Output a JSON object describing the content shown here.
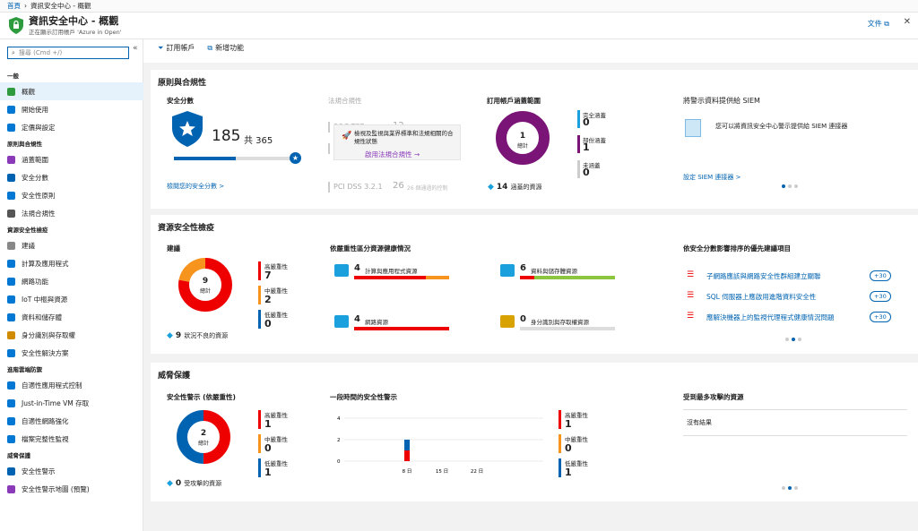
{
  "breadcrumb": {
    "home": "首頁",
    "current": "資訊安全中心 - 概觀"
  },
  "header": {
    "title": "資訊安全中心 - 概觀",
    "subtitle": "正在顯示訂用帳戶 'Azure in Open'",
    "docs": "文件",
    "close": "✕"
  },
  "search": {
    "placeholder": "搜尋 (Cmd +/)"
  },
  "sidebar": {
    "sections": [
      {
        "title": "一般",
        "items": [
          {
            "label": "概觀",
            "color": "#2e9c3e"
          },
          {
            "label": "開始使用",
            "color": "#0078d4"
          },
          {
            "label": "定價與設定",
            "color": "#0078d4"
          }
        ]
      },
      {
        "title": "原則與合規性",
        "items": [
          {
            "label": "涵蓋範圍",
            "color": "#8a3ab9"
          },
          {
            "label": "安全分數",
            "color": "#0063b1"
          },
          {
            "label": "安全性原則",
            "color": "#0078d4"
          },
          {
            "label": "法規合規性",
            "color": "#555"
          }
        ]
      },
      {
        "title": "資源安全性檢疫",
        "items": [
          {
            "label": "建議",
            "color": "#888"
          },
          {
            "label": "計算及應用程式",
            "color": "#0078d4"
          },
          {
            "label": "網路功能",
            "color": "#0078d4"
          },
          {
            "label": "IoT 中樞與資源",
            "color": "#0078d4"
          },
          {
            "label": "資料和儲存體",
            "color": "#0078d4"
          },
          {
            "label": "身分識別與存取權",
            "color": "#d18b00"
          },
          {
            "label": "安全性解決方案",
            "color": "#0078d4"
          }
        ]
      },
      {
        "title": "進階雲端防禦",
        "items": [
          {
            "label": "自適性應用程式控制",
            "color": "#0078d4"
          },
          {
            "label": "Just-in-Time VM 存取",
            "color": "#0078d4"
          },
          {
            "label": "自適性網路強化",
            "color": "#0078d4"
          },
          {
            "label": "檔案完整性監視",
            "color": "#0078d4"
          }
        ]
      },
      {
        "title": "威脅保護",
        "items": [
          {
            "label": "安全性警示",
            "color": "#0063b1"
          },
          {
            "label": "安全性警示地圖 (預覽)",
            "color": "#8a3ab9"
          }
        ]
      }
    ]
  },
  "toolbar": {
    "subscriptions": "訂用帳戶",
    "whats_new": "新增功能"
  },
  "policy": {
    "title": "原則與合規性",
    "score": {
      "label": "安全分數",
      "value": "185",
      "total": "共 365",
      "fraction": 0.507,
      "link": "檢閱您的安全分數 >"
    },
    "compliance": {
      "label": "法規合規性",
      "rows": [
        {
          "name": "SOC TSR",
          "num": "12",
          "txt": "12 個通過的控制"
        },
        {
          "name": "ISO 27001",
          "num": "",
          "txt": ""
        },
        {
          "name": "PCI DSS 3.2.1",
          "num": "26",
          "txt": "26 個通過的控制"
        }
      ],
      "overlay_text": "檢視及監視與業界標準和法規相關的合規性狀態",
      "overlay_link": "啟用法規合規性 →"
    },
    "coverage": {
      "label": "訂用帳戶涵蓋範圍",
      "center_num": "1",
      "center_txt": "總計",
      "items": [
        {
          "name": "完全涵蓋",
          "value": "0",
          "color": "#1aa0dd"
        },
        {
          "name": "部份涵蓋",
          "value": "1",
          "color": "#7a1577"
        },
        {
          "name": "未涵蓋",
          "value": "0",
          "color": "#ccc"
        }
      ],
      "footer_num": "14",
      "footer_txt": "涵蓋的資源"
    },
    "siem": {
      "label": "將警示資料提供給 SIEM",
      "text": "您可以將資訊安全中心警示提供給 SIEM 連接器",
      "link": "設定 SIEM 連接器 >"
    }
  },
  "hygiene": {
    "title": "資源安全性檢疫",
    "recs": {
      "label": "建議",
      "center_num": "9",
      "center_txt": "總計",
      "high": {
        "name": "高嚴重性",
        "value": "7"
      },
      "medium": {
        "name": "中嚴重性",
        "value": "2"
      },
      "low": {
        "name": "低嚴重性",
        "value": "0"
      },
      "footer_num": "9",
      "footer_txt": "狀況不良的資源"
    },
    "health": {
      "label": "依嚴重性區分資源健康情況",
      "items": [
        {
          "num": "4",
          "name": "計算與應用程式資源",
          "red": 0.75,
          "orange": 0.25,
          "green": 0
        },
        {
          "num": "6",
          "name": "資料與儲存體資源",
          "red": 0.15,
          "orange": 0,
          "green": 0.85
        },
        {
          "num": "4",
          "name": "網路資源",
          "red": 1,
          "orange": 0,
          "green": 0
        },
        {
          "num": "0",
          "name": "身分識別與存取權資源",
          "red": 0,
          "orange": 0,
          "green": 0
        }
      ]
    },
    "top": {
      "label": "依安全分數影響排序的優先建議項目",
      "items": [
        {
          "text": "子網路應該與網路安全性群組建立關聯",
          "badge": "+30"
        },
        {
          "text": "SQL 伺服器上應啟用進階資料安全性",
          "badge": "+30"
        },
        {
          "text": "應解決機器上的監視代理程式健康情況問題",
          "badge": "+30"
        }
      ]
    }
  },
  "threat": {
    "title": "威脅保護",
    "alerts": {
      "label": "安全性警示 (依嚴重性)",
      "center_num": "2",
      "center_txt": "總計",
      "high": {
        "name": "高嚴重性",
        "value": "1"
      },
      "medium": {
        "name": "中嚴重性",
        "value": "0"
      },
      "low": {
        "name": "低嚴重性",
        "value": "1"
      },
      "footer_num": "0",
      "footer_txt": "受攻擊的資源"
    },
    "overtime": {
      "label": "一段時間的安全性警示",
      "high": {
        "name": "高嚴重性",
        "value": "1"
      },
      "medium": {
        "name": "中嚴重性",
        "value": "0"
      },
      "low": {
        "name": "低嚴重性",
        "value": "1"
      }
    },
    "attacked": {
      "label": "受到最多攻擊的資源",
      "empty": "沒有結果"
    }
  },
  "chart_data": {
    "type": "bar",
    "title": "一段時間的安全性警示",
    "categories": [
      "8 日",
      "15 日",
      "22 日"
    ],
    "x": [
      "8 日",
      "15 日",
      "22 日"
    ],
    "series": [
      {
        "name": "高嚴重性",
        "values": [
          1,
          0,
          0
        ]
      },
      {
        "name": "低嚴重性",
        "values": [
          1,
          0,
          0
        ]
      }
    ],
    "yticks": [
      "0",
      "2",
      "4"
    ],
    "ylim": [
      0,
      4
    ]
  }
}
